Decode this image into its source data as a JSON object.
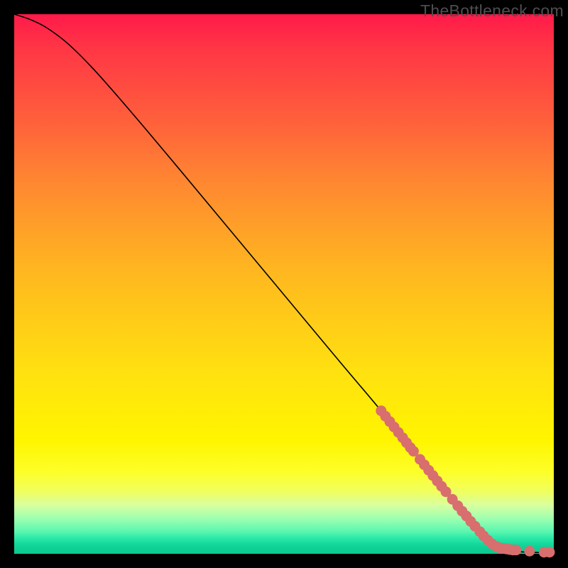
{
  "watermark": "TheBottleneck.com",
  "chart_data": {
    "type": "line",
    "title": "",
    "xlabel": "",
    "ylabel": "",
    "xlim": [
      0,
      100
    ],
    "ylim": [
      0,
      100
    ],
    "grid": false,
    "series": [
      {
        "name": "curve",
        "kind": "line",
        "color": "#000000",
        "points": [
          {
            "x": 0,
            "y": 100
          },
          {
            "x": 3,
            "y": 99
          },
          {
            "x": 6,
            "y": 97.5
          },
          {
            "x": 10,
            "y": 94.5
          },
          {
            "x": 15,
            "y": 89.5
          },
          {
            "x": 22,
            "y": 81.5
          },
          {
            "x": 30,
            "y": 72
          },
          {
            "x": 40,
            "y": 60
          },
          {
            "x": 50,
            "y": 48
          },
          {
            "x": 60,
            "y": 36
          },
          {
            "x": 68,
            "y": 26.5
          },
          {
            "x": 74,
            "y": 19
          },
          {
            "x": 80,
            "y": 11.5
          },
          {
            "x": 85,
            "y": 5.5
          },
          {
            "x": 88,
            "y": 2.5
          },
          {
            "x": 90,
            "y": 1.2
          },
          {
            "x": 92,
            "y": 0.6
          },
          {
            "x": 95,
            "y": 0.3
          },
          {
            "x": 100,
            "y": 0.2
          }
        ]
      },
      {
        "name": "scatter",
        "kind": "scatter",
        "color": "#d86e6e",
        "points": [
          {
            "x": 68.0,
            "y": 26.5
          },
          {
            "x": 68.8,
            "y": 25.5
          },
          {
            "x": 69.6,
            "y": 24.5
          },
          {
            "x": 70.4,
            "y": 23.5
          },
          {
            "x": 71.2,
            "y": 22.5
          },
          {
            "x": 72.0,
            "y": 21.5
          },
          {
            "x": 72.7,
            "y": 20.6
          },
          {
            "x": 73.4,
            "y": 19.7
          },
          {
            "x": 74.0,
            "y": 19.0
          },
          {
            "x": 75.2,
            "y": 17.5
          },
          {
            "x": 76.0,
            "y": 16.5
          },
          {
            "x": 76.8,
            "y": 15.5
          },
          {
            "x": 77.6,
            "y": 14.5
          },
          {
            "x": 78.4,
            "y": 13.5
          },
          {
            "x": 79.2,
            "y": 12.5
          },
          {
            "x": 80.0,
            "y": 11.5
          },
          {
            "x": 81.2,
            "y": 10.1
          },
          {
            "x": 82.2,
            "y": 8.9
          },
          {
            "x": 83.0,
            "y": 7.9
          },
          {
            "x": 83.8,
            "y": 7.0
          },
          {
            "x": 84.6,
            "y": 6.0
          },
          {
            "x": 85.4,
            "y": 5.1
          },
          {
            "x": 86.3,
            "y": 4.1
          },
          {
            "x": 87.0,
            "y": 3.3
          },
          {
            "x": 87.8,
            "y": 2.5
          },
          {
            "x": 88.6,
            "y": 1.8
          },
          {
            "x": 89.4,
            "y": 1.3
          },
          {
            "x": 90.0,
            "y": 1.1
          },
          {
            "x": 90.6,
            "y": 1.0
          },
          {
            "x": 91.2,
            "y": 0.9
          },
          {
            "x": 91.8,
            "y": 0.8
          },
          {
            "x": 92.4,
            "y": 0.7
          },
          {
            "x": 93.0,
            "y": 0.7
          },
          {
            "x": 95.5,
            "y": 0.5
          },
          {
            "x": 98.2,
            "y": 0.3
          },
          {
            "x": 99.2,
            "y": 0.3
          }
        ]
      }
    ]
  }
}
